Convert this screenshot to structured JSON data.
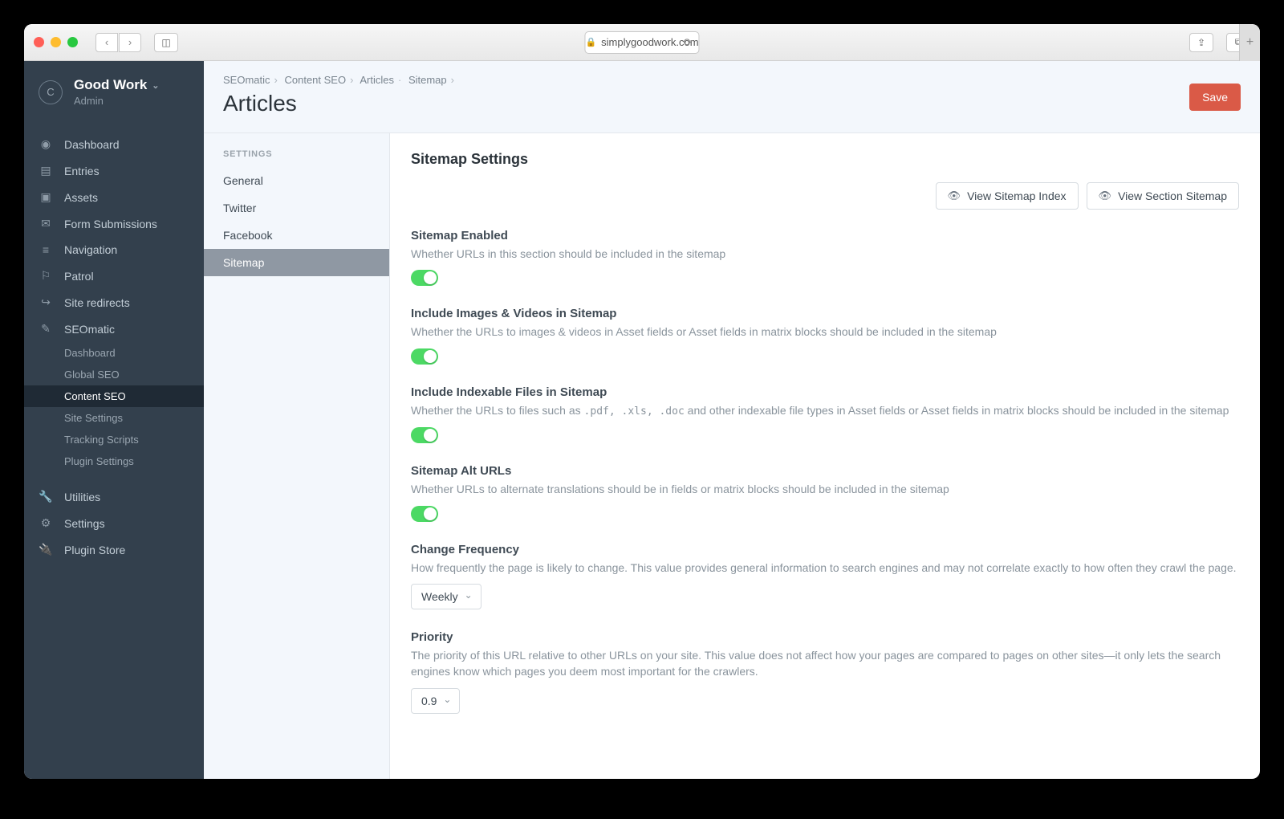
{
  "browser": {
    "url": "simplygoodwork.com"
  },
  "brand": {
    "name": "Good Work",
    "role": "Admin",
    "initial": "C"
  },
  "sidebar_nav": {
    "dashboard": "Dashboard",
    "entries": "Entries",
    "assets": "Assets",
    "form_submissions": "Form Submissions",
    "navigation": "Navigation",
    "patrol": "Patrol",
    "site_redirects": "Site redirects",
    "seomatic": "SEOmatic",
    "seomatic_sub": {
      "dashboard": "Dashboard",
      "global_seo": "Global SEO",
      "content_seo": "Content SEO",
      "site_settings": "Site Settings",
      "tracking_scripts": "Tracking Scripts",
      "plugin_settings": "Plugin Settings"
    },
    "utilities": "Utilities",
    "settings": "Settings",
    "plugin_store": "Plugin Store"
  },
  "settings_col": {
    "heading": "SETTINGS",
    "general": "General",
    "twitter": "Twitter",
    "facebook": "Facebook",
    "sitemap": "Sitemap"
  },
  "breadcrumbs": [
    "SEOmatic",
    "Content SEO",
    "Articles",
    "Sitemap"
  ],
  "page_title": "Articles",
  "save_label": "Save",
  "section_title": "Sitemap Settings",
  "view_buttons": {
    "index": "View Sitemap Index",
    "section": "View Section Sitemap"
  },
  "fields": {
    "enabled": {
      "label": "Sitemap Enabled",
      "help": "Whether URLs in this section should be included in the sitemap"
    },
    "images": {
      "label": "Include Images & Videos in Sitemap",
      "help": "Whether the URLs to images & videos in Asset fields or Asset fields in matrix blocks should be included in the sitemap"
    },
    "files": {
      "label": "Include Indexable Files in Sitemap",
      "help_pre": "Whether the URLs to files such as ",
      "help_code": ".pdf, .xls, .doc",
      "help_post": " and other indexable file types in Asset fields or Asset fields in matrix blocks should be included in the sitemap"
    },
    "alt_urls": {
      "label": "Sitemap Alt URLs",
      "help": "Whether URLs to alternate translations should be in fields or matrix blocks should be included in the sitemap"
    },
    "change_freq": {
      "label": "Change Frequency",
      "help": "How frequently the page is likely to change. This value provides general information to search engines and may not correlate exactly to how often they crawl the page.",
      "value": "Weekly"
    },
    "priority": {
      "label": "Priority",
      "help": "The priority of this URL relative to other URLs on your site. This value does not affect how your pages are compared to pages on other sites—it only lets the search engines know which pages you deem most important for the crawlers.",
      "value": "0.9"
    }
  }
}
